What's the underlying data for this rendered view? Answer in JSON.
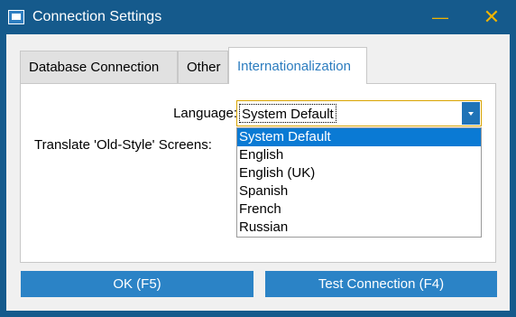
{
  "window": {
    "title": "Connection Settings",
    "minimize": "—",
    "close": "✕"
  },
  "tabs": [
    {
      "label": "Database Connection"
    },
    {
      "label": "Other"
    },
    {
      "label": "Internationalization",
      "active": true
    }
  ],
  "form": {
    "language_label": "Language:",
    "language_value": "System Default",
    "translate_label": "Translate 'Old-Style' Screens:"
  },
  "dropdown": {
    "options": [
      "System Default",
      "English",
      "English (UK)",
      "Spanish",
      "French",
      "Russian"
    ],
    "selected_index": 0
  },
  "buttons": {
    "ok": "OK (F5)",
    "test": "Test Connection (F4)"
  },
  "colors": {
    "titlebar": "#155a8c",
    "accent": "#2b83c6",
    "selection": "#0a7ad4",
    "focus_border": "#d9a400",
    "title_buttons": "#f0b400"
  }
}
